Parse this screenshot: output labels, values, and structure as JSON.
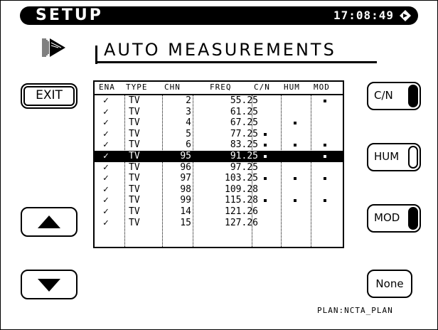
{
  "header": {
    "title": "SETUP",
    "time": "17:08:49"
  },
  "page": {
    "heading": "AUTO MEASUREMENTS"
  },
  "buttons": {
    "exit": "EXIT",
    "cn": "C/N",
    "hum": "HUM",
    "mod": "MOD",
    "none": "None"
  },
  "toggles": {
    "cn": "on",
    "hum": "off",
    "mod": "on"
  },
  "plan": "PLAN:NCTA_PLAN",
  "table": {
    "headers": [
      "ENA",
      "TYPE",
      "CHN",
      "FREQ",
      "C/N",
      "HUM",
      "MOD"
    ],
    "selected_row": 5,
    "rows": [
      {
        "ena": "✓",
        "type": "TV",
        "chn": "2",
        "freq": "55.25",
        "cn": false,
        "hum": false,
        "mod": true
      },
      {
        "ena": "✓",
        "type": "TV",
        "chn": "3",
        "freq": "61.25",
        "cn": false,
        "hum": false,
        "mod": false
      },
      {
        "ena": "✓",
        "type": "TV",
        "chn": "4",
        "freq": "67.25",
        "cn": false,
        "hum": true,
        "mod": false
      },
      {
        "ena": "✓",
        "type": "TV",
        "chn": "5",
        "freq": "77.25",
        "cn": true,
        "hum": false,
        "mod": false
      },
      {
        "ena": "✓",
        "type": "TV",
        "chn": "6",
        "freq": "83.25",
        "cn": true,
        "hum": true,
        "mod": true
      },
      {
        "ena": "✓",
        "type": "TV",
        "chn": "95",
        "freq": "91.25",
        "cn": true,
        "hum": false,
        "mod": true
      },
      {
        "ena": "✓",
        "type": "TV",
        "chn": "96",
        "freq": "97.25",
        "cn": false,
        "hum": false,
        "mod": false
      },
      {
        "ena": "✓",
        "type": "TV",
        "chn": "97",
        "freq": "103.25",
        "cn": true,
        "hum": true,
        "mod": true
      },
      {
        "ena": "✓",
        "type": "TV",
        "chn": "98",
        "freq": "109.28",
        "cn": false,
        "hum": false,
        "mod": false
      },
      {
        "ena": "✓",
        "type": "TV",
        "chn": "99",
        "freq": "115.28",
        "cn": true,
        "hum": true,
        "mod": true
      },
      {
        "ena": "✓",
        "type": "TV",
        "chn": "14",
        "freq": "121.26",
        "cn": false,
        "hum": false,
        "mod": false
      },
      {
        "ena": "✓",
        "type": "TV",
        "chn": "15",
        "freq": "127.26",
        "cn": false,
        "hum": false,
        "mod": false
      }
    ]
  },
  "icons": {
    "header_status": "diamond-arrow-icon",
    "page_icon": "arrow-page-icon",
    "scroll_up": "triangle-up-icon",
    "scroll_down": "triangle-down-icon"
  }
}
